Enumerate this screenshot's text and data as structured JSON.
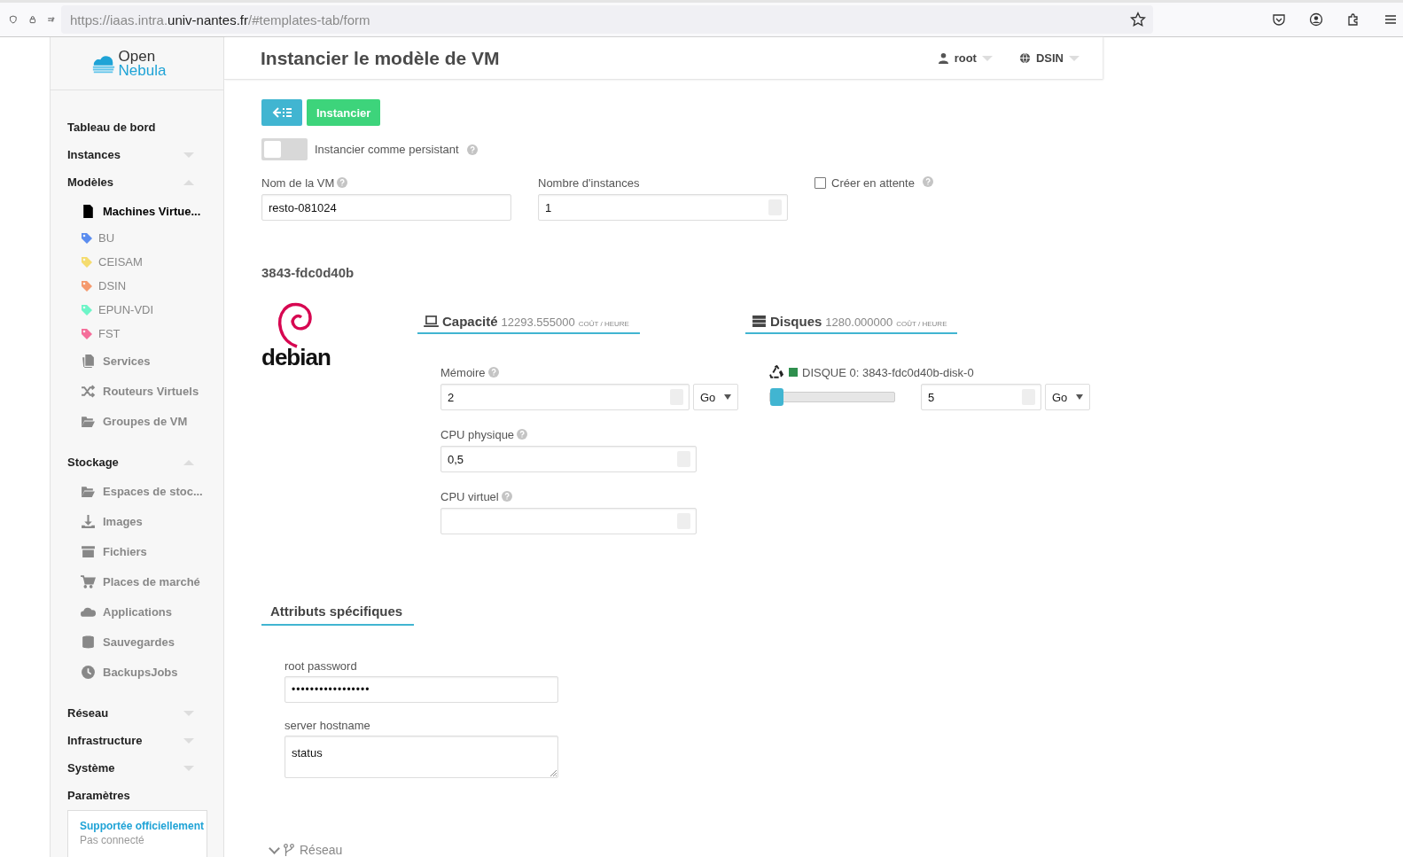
{
  "browser": {
    "url": "https://iaas.intra.**univ-nantes.fr**/#templates-tab/form"
  },
  "sidebar": {
    "logo": {
      "line_1": "Open",
      "line_2": "Nebula"
    },
    "menu": [
      {
        "label": "Tableau de bord",
        "kind": "link"
      },
      {
        "label": "Instances",
        "kind": "section",
        "expanded": false
      },
      {
        "label": "Modèles",
        "kind": "section",
        "expanded": true,
        "children": [
          {
            "label": "Machines Virtue...",
            "kind": "item",
            "selected": true
          },
          {
            "label": "BU",
            "kind": "tag",
            "color": "#5b8def"
          },
          {
            "label": "CEISAM",
            "kind": "tag",
            "color": "#f5dc6e"
          },
          {
            "label": "DSIN",
            "kind": "tag",
            "color": "#f59a6e"
          },
          {
            "label": "EPUN-VDI",
            "kind": "tag",
            "color": "#6ef5c8"
          },
          {
            "label": "FST",
            "kind": "tag",
            "color": "#f56e9a"
          },
          {
            "label": "Services",
            "kind": "item",
            "selected": false
          },
          {
            "label": "Routeurs Virtuels",
            "kind": "item",
            "selected": false
          },
          {
            "label": "Groupes de VM",
            "kind": "item",
            "selected": false
          }
        ]
      },
      {
        "label": "Stockage",
        "kind": "section",
        "expanded": true,
        "children": [
          {
            "label": "Espaces de stoc...",
            "kind": "item",
            "selected": false
          },
          {
            "label": "Images",
            "kind": "item",
            "selected": false
          },
          {
            "label": "Fichiers",
            "kind": "item",
            "selected": false
          },
          {
            "label": "Places de marché",
            "kind": "item",
            "selected": false
          },
          {
            "label": "Applications",
            "kind": "item",
            "selected": false
          },
          {
            "label": "Sauvegardes",
            "kind": "item",
            "selected": false
          },
          {
            "label": "BackupsJobs",
            "kind": "item",
            "selected": false
          }
        ]
      },
      {
        "label": "Réseau",
        "kind": "section",
        "expanded": false
      },
      {
        "label": "Infrastructure",
        "kind": "section",
        "expanded": false
      },
      {
        "label": "Système",
        "kind": "section",
        "expanded": false
      },
      {
        "label": "Paramètres",
        "kind": "link"
      }
    ],
    "support": {
      "link": "Supportée officiellement",
      "status": "Pas connecté"
    }
  },
  "header": {
    "title": "Instancier le modèle de VM",
    "user": "root",
    "zone": "DSIN"
  },
  "form": {
    "submit": "Instancier",
    "persistent": {
      "label": "Instancier comme persistant",
      "on": false
    },
    "vm_name": {
      "label": "Nom de la VM",
      "value": "resto-081024"
    },
    "instances": {
      "label": "Nombre d'instances",
      "value": "1"
    },
    "hold": {
      "label": "Créer en attente",
      "checked": false
    },
    "template": "3843-fdc0d40b",
    "logo_text": "debian",
    "capacity": {
      "title": "Capacité",
      "cost": "12293.555000",
      "unit": "COÛT / HEURE"
    },
    "disks": {
      "title": "Disques",
      "cost": "1280.000000",
      "unit": "COÛT / HEURE"
    },
    "memory": {
      "label": "Mémoire",
      "value": "2",
      "unit": "Go"
    },
    "cpu": {
      "label": "CPU physique",
      "value": "0,5"
    },
    "vcpu": {
      "label": "CPU virtuel"
    },
    "disk": {
      "label": "DISQUE 0: 3843-fdc0d40b-disk-0",
      "level": 0,
      "value": "5",
      "unit": "Go"
    },
    "attributes": {
      "title": "Attributs spécifiques",
      "fields": [
        {
          "label": "root password",
          "kind": "password",
          "value": "•••••••••••••••••"
        },
        {
          "label": "server hostname",
          "kind": "textarea",
          "value": "status"
        }
      ]
    },
    "network": {
      "label": "Réseau",
      "expanded": false
    }
  }
}
